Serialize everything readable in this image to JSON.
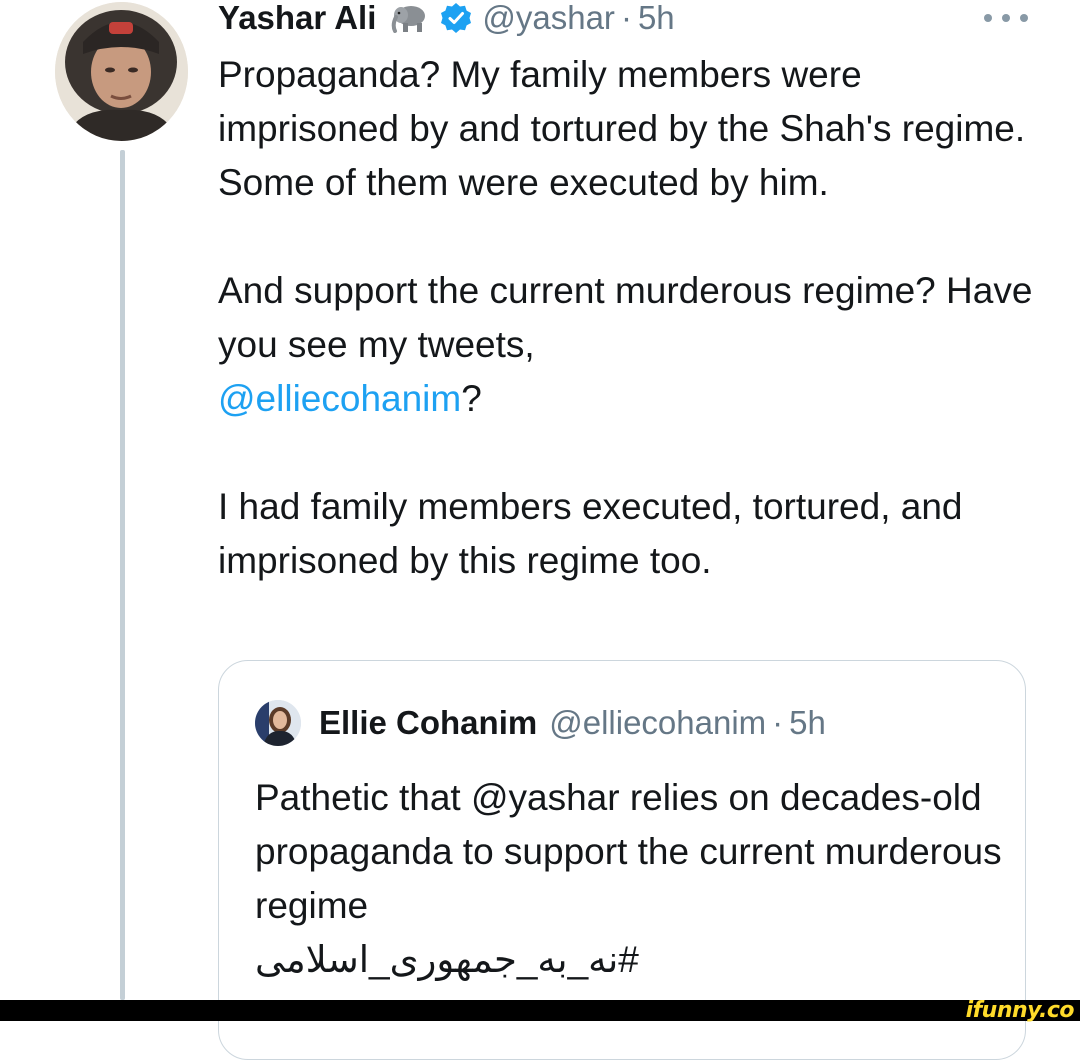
{
  "tweet": {
    "author_name": "Yashar Ali",
    "author_emoji_icon": "elephant-icon",
    "verified_icon": "verified-badge-icon",
    "handle": "@yashar",
    "separator": "·",
    "time": "5h",
    "more_icon": "more-options-icon",
    "paragraph1": "Propaganda? My family members were imprisoned by and tortured by the Shah's regime. Some of them were executed by him.",
    "paragraph2_text": "And support the current murderous regime? Have you see my tweets,",
    "paragraph2_mention": "@elliecohanim",
    "paragraph2_end": "?",
    "paragraph3": "I had family members executed, tortured, and imprisoned by this regime too."
  },
  "quoted_tweet": {
    "author_name": "Ellie Cohanim",
    "handle": "@elliecohanim",
    "separator": "·",
    "time": "5h",
    "text": "Pathetic that @yashar relies on decades-old propaganda to support the current murderous regime",
    "hashtag": "#نه_به_جمهوری_اسلامی"
  },
  "watermark": "ifunny.co",
  "colors": {
    "text": "#14171a",
    "secondary": "#657786",
    "link": "#1da1f2",
    "verified": "#1da1f2",
    "thread_line": "#c4cfd6",
    "border": "#ccd6dd",
    "watermark": "#ffdb2a"
  }
}
